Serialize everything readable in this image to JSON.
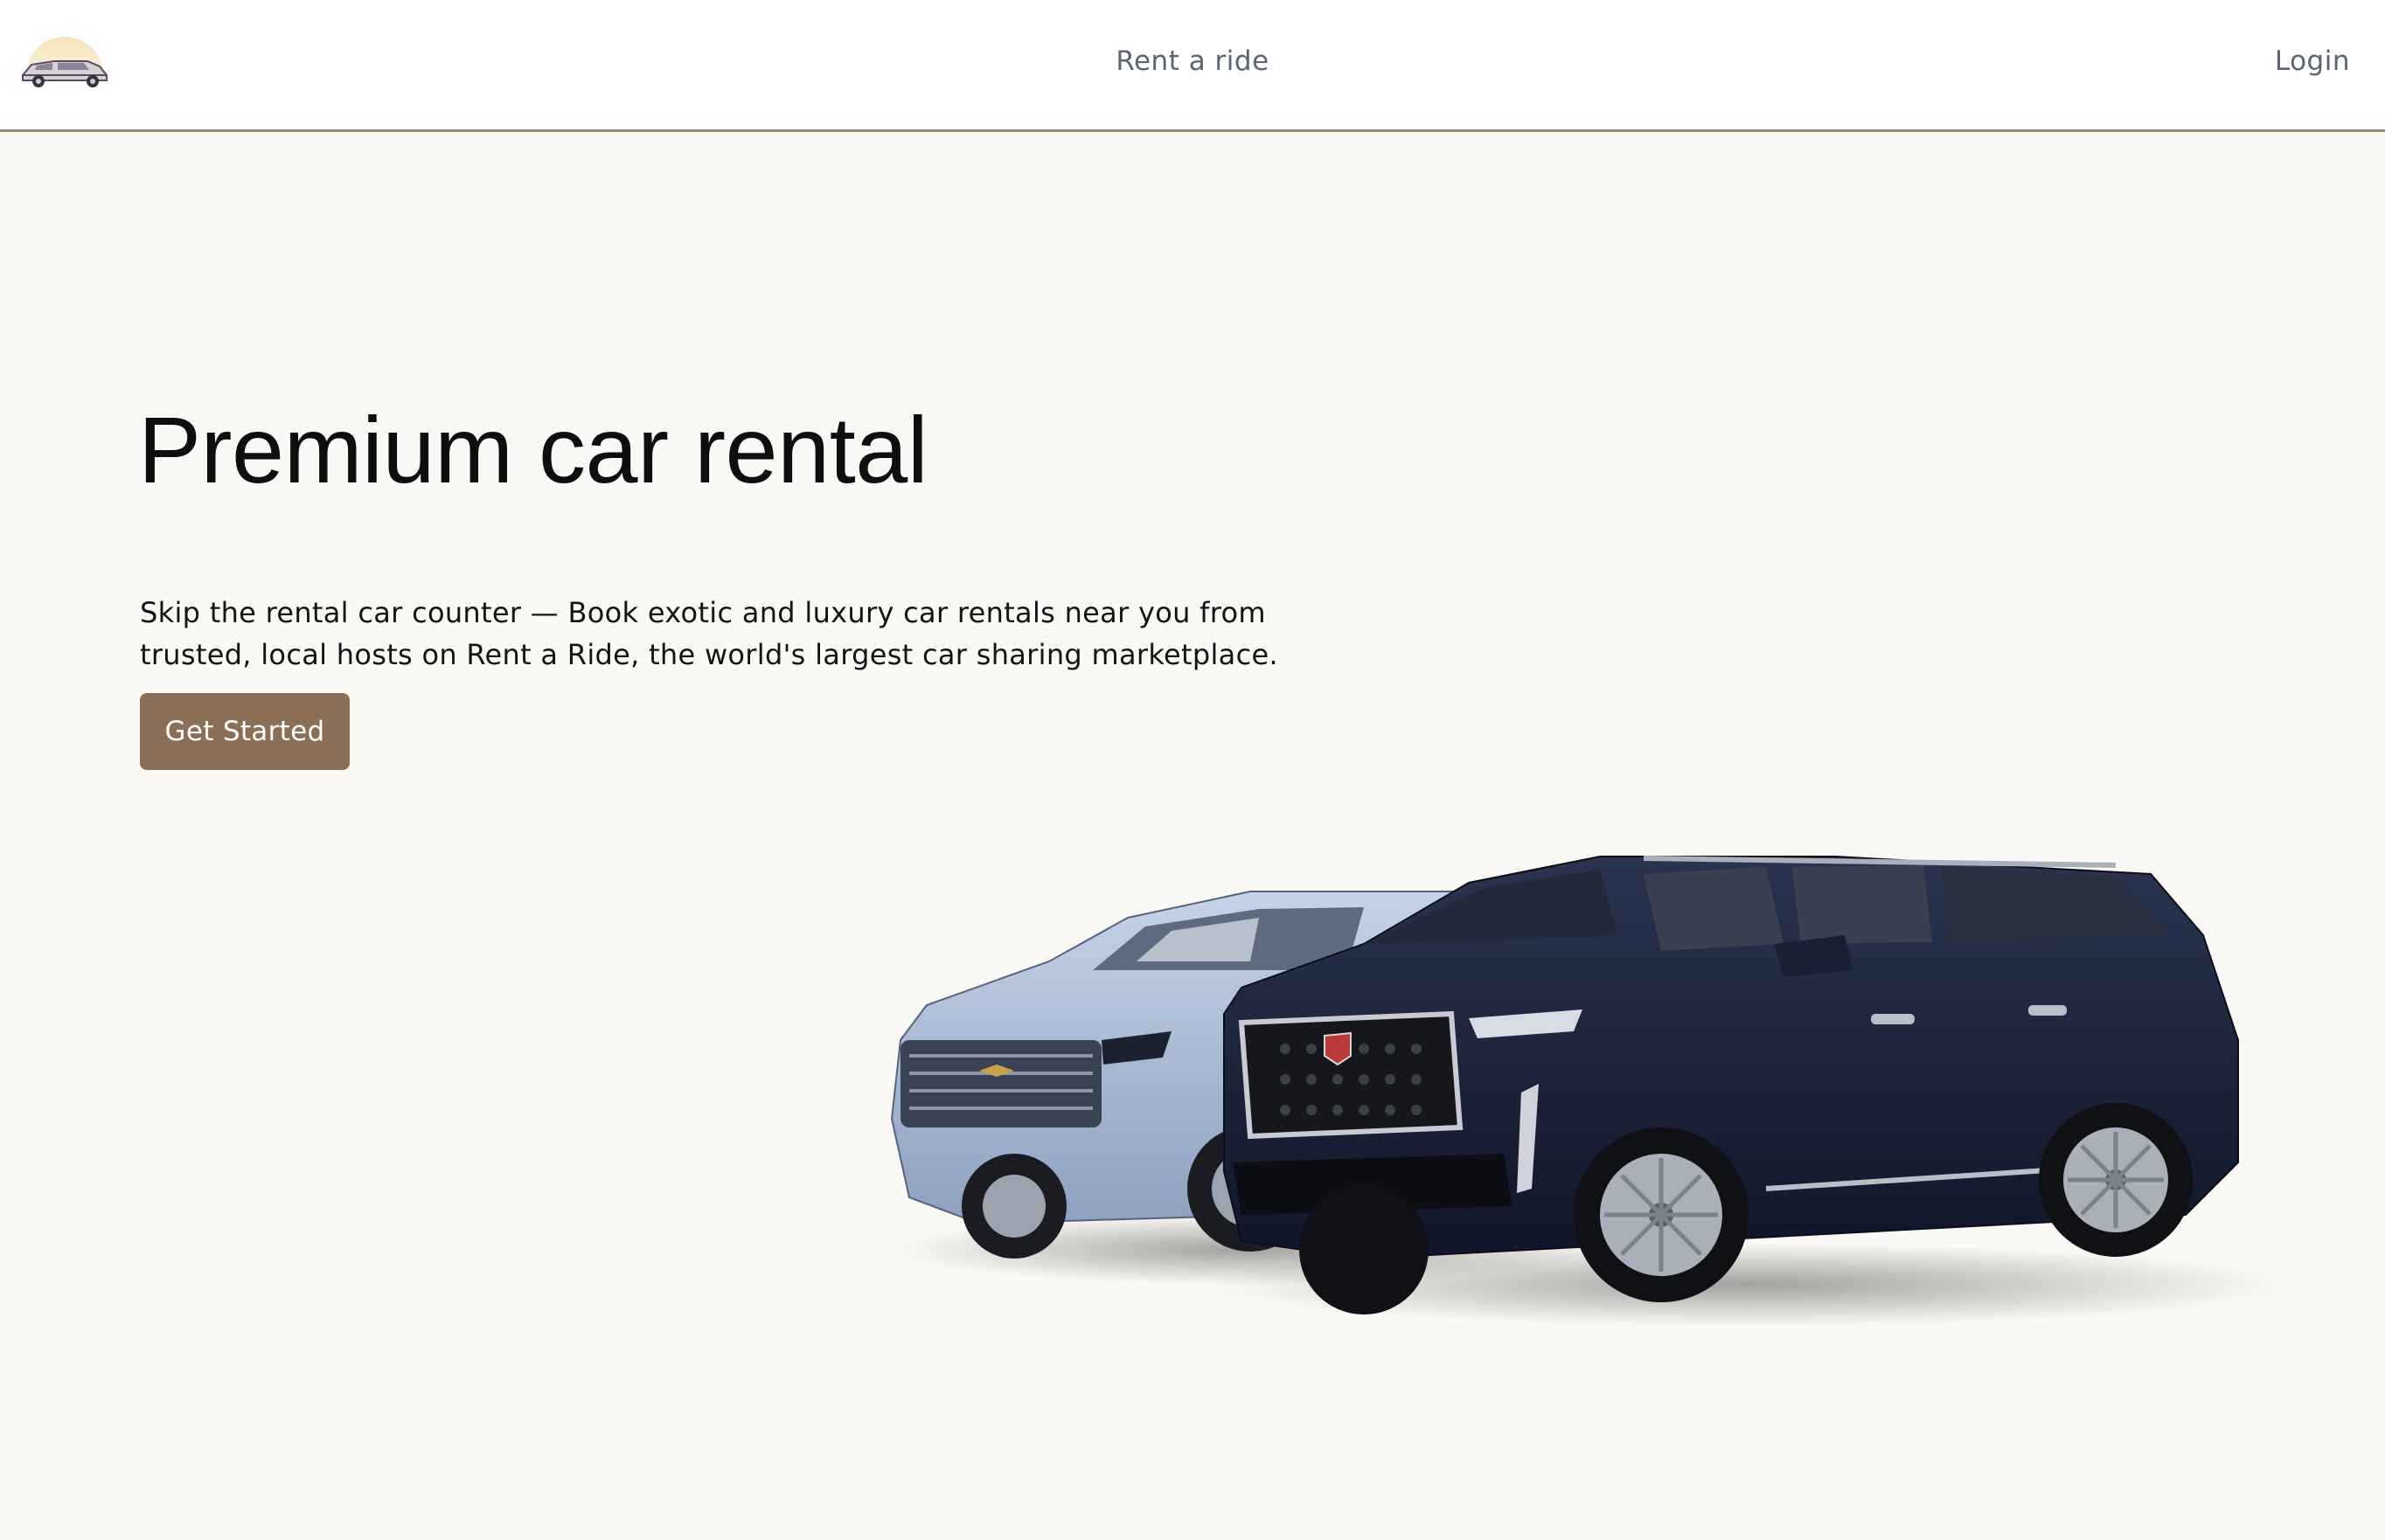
{
  "brand": {
    "logo_icon": "limousine-logo-icon"
  },
  "nav": {
    "center_link": "Rent a ride",
    "login": "Login"
  },
  "hero": {
    "title": "Premium car rental",
    "description": "Skip the rental car counter — Book exotic and luxury car rentals near you from trusted, local hosts on Rent a Ride, the world's largest car sharing marketplace.",
    "cta": "Get Started",
    "image_icon": "suv-pair-image"
  },
  "colors": {
    "accent": "#8a6f56",
    "nav_border": "#9d8a76",
    "background": "#fbf9f5",
    "nav_text": "#5c6470"
  }
}
